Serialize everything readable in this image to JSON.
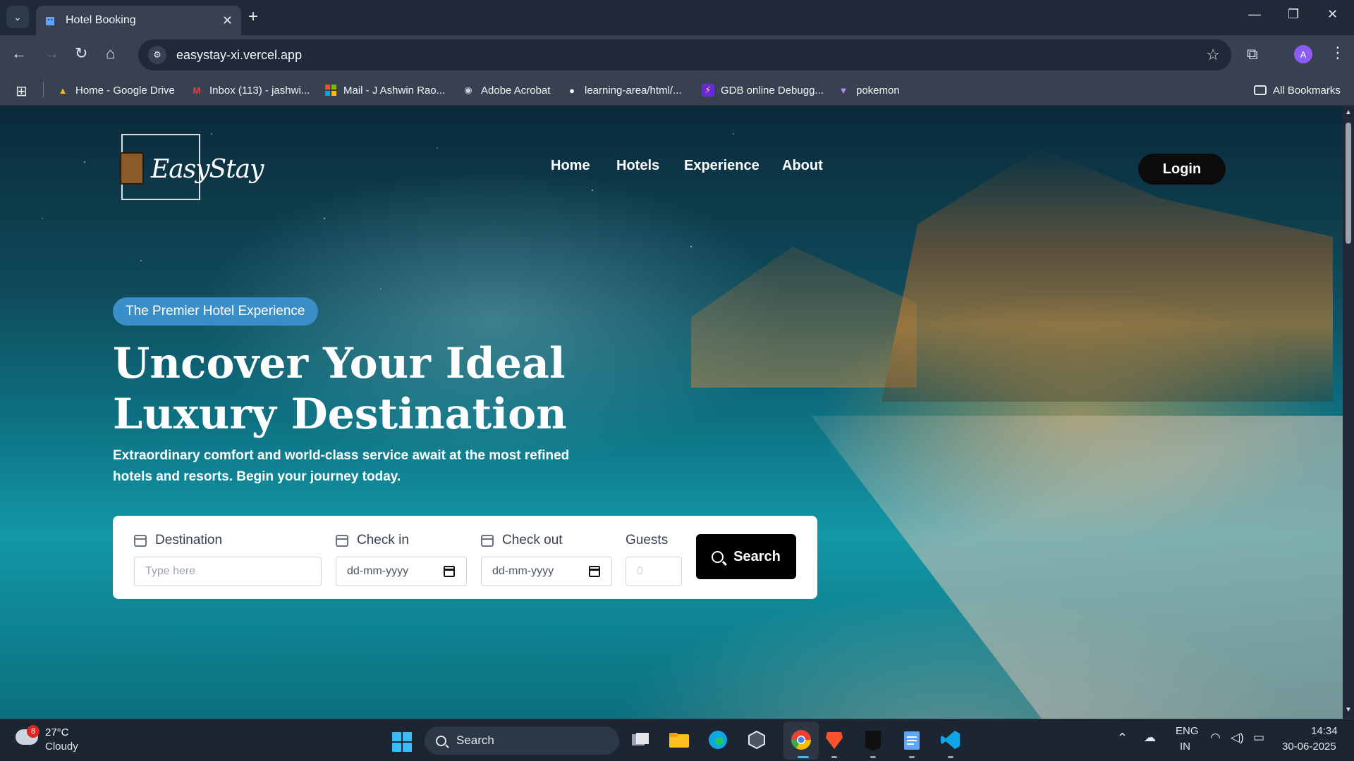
{
  "browser": {
    "tab_title": "Hotel Booking",
    "url": "easystay-xi.vercel.app",
    "profile_initial": "A",
    "bookmarks": [
      {
        "label": "Home - Google Drive",
        "icon": "google-drive-icon",
        "color": "#fbbc04"
      },
      {
        "label": "Inbox (113) - jashwi...",
        "icon": "gmail-icon",
        "color": "#ea4335"
      },
      {
        "label": "Mail - J Ashwin Rao...",
        "icon": "microsoft-icon",
        "color": "#f25022"
      },
      {
        "label": "Adobe Acrobat",
        "icon": "acrobat-icon",
        "color": "#9ca3af"
      },
      {
        "label": "learning-area/html/...",
        "icon": "github-icon",
        "color": "#ffffff"
      },
      {
        "label": "GDB online Debugg...",
        "icon": "gdb-icon",
        "color": "#7c3aed"
      },
      {
        "label": "pokemon",
        "icon": "pokemon-icon",
        "color": "#a855f7"
      }
    ],
    "all_bookmarks": "All Bookmarks"
  },
  "site": {
    "logo_text": "EasyStay",
    "nav": [
      "Home",
      "Hotels",
      "Experience",
      "About"
    ],
    "login": "Login",
    "badge": "The Premier Hotel Experience",
    "headline_line1": "Uncover Your Ideal",
    "headline_line2": "Luxury Destination",
    "subtext": "Extraordinary comfort and world-class service await at the most refined hotels and resorts. Begin your journey today.",
    "search": {
      "destination_label": "Destination",
      "destination_placeholder": "Type here",
      "checkin_label": "Check in",
      "checkin_value": "dd-mm-yyyy",
      "checkout_label": "Check out",
      "checkout_value": "dd-mm-yyyy",
      "guests_label": "Guests",
      "guests_placeholder": "0",
      "button": "Search"
    }
  },
  "taskbar": {
    "weather_temp": "27°C",
    "weather_desc": "Cloudy",
    "weather_badge": "8",
    "search_label": "Search",
    "lang_top": "ENG",
    "lang_bottom": "IN",
    "time": "14:34",
    "date": "30-06-2025"
  }
}
